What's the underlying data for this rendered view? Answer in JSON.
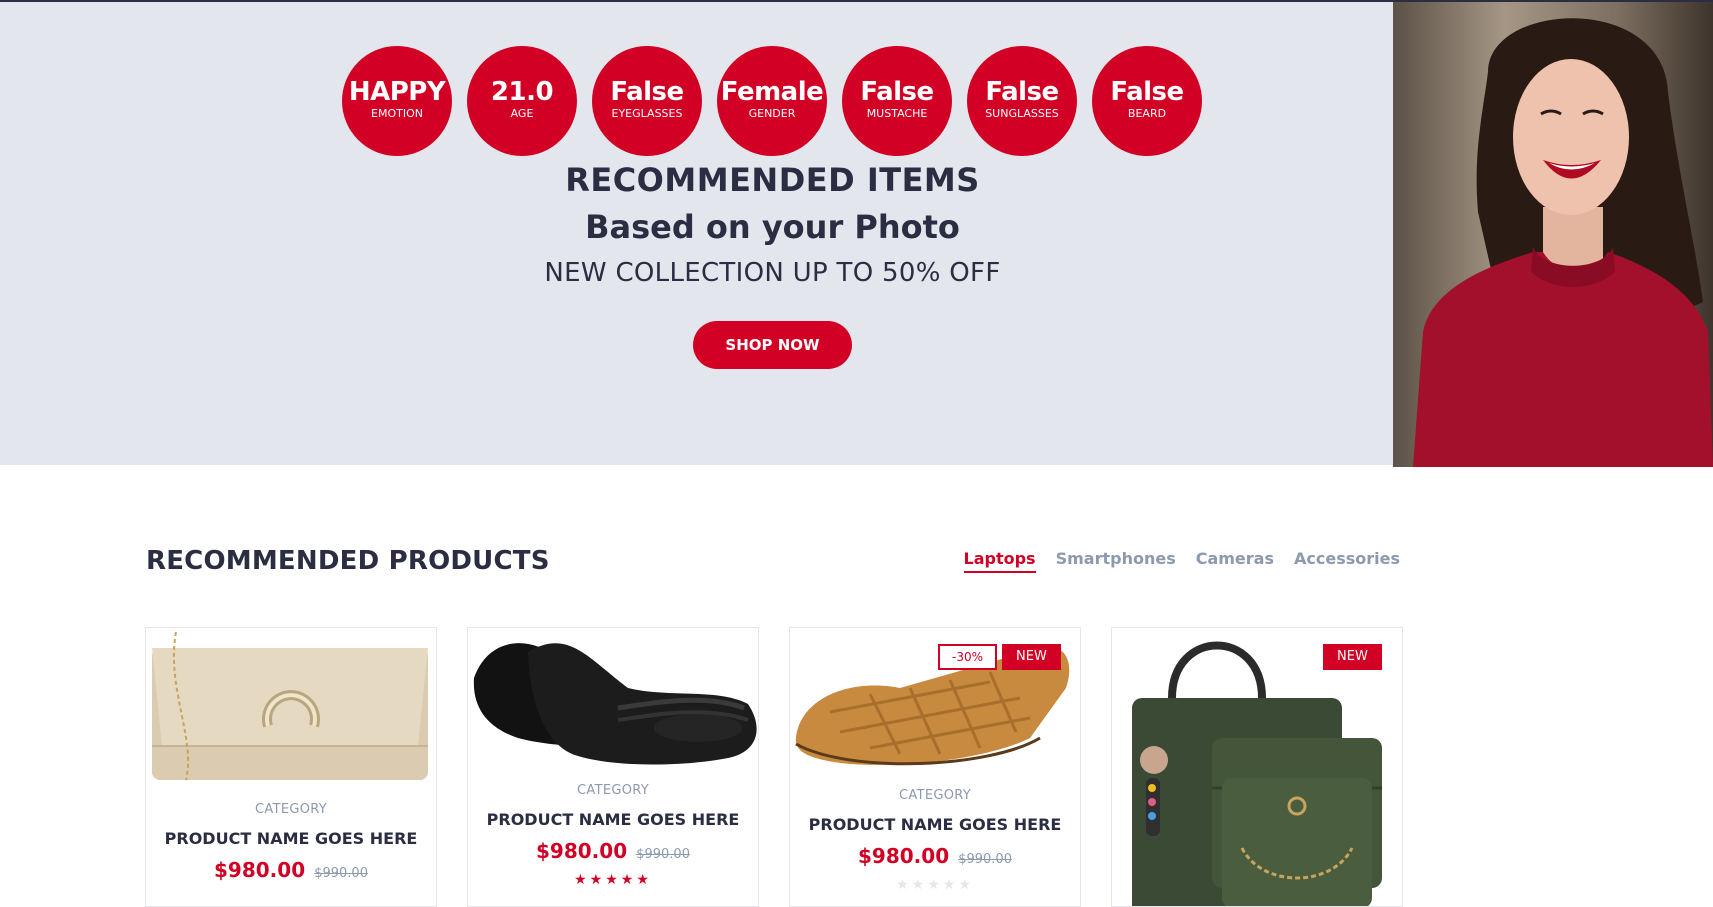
{
  "hero": {
    "attributes": [
      {
        "value": "HAPPY",
        "label": "EMOTION"
      },
      {
        "value": "21.0",
        "label": "AGE"
      },
      {
        "value": "False",
        "label": "EYEGLASSES"
      },
      {
        "value": "Female",
        "label": "GENDER"
      },
      {
        "value": "False",
        "label": "MUSTACHE"
      },
      {
        "value": "False",
        "label": "SUNGLASSES"
      },
      {
        "value": "False",
        "label": "BEARD"
      }
    ],
    "title": "RECOMMENDED ITEMS",
    "subtitle": "Based on your Photo",
    "offer": "NEW COLLECTION UP TO 50% OFF",
    "cta": "SHOP NOW"
  },
  "products_section": {
    "title": "RECOMMENDED PRODUCTS",
    "tabs": [
      "Laptops",
      "Smartphones",
      "Cameras",
      "Accessories"
    ],
    "active_tab": "Laptops"
  },
  "products": [
    {
      "category": "CATEGORY",
      "name": "PRODUCT NAME GOES HERE",
      "price": "$980.00",
      "old_price": "$990.00",
      "image": "gold-clutch-bag",
      "badges": []
    },
    {
      "category": "CATEGORY",
      "name": "PRODUCT NAME GOES HERE",
      "price": "$980.00",
      "old_price": "$990.00",
      "image": "black-flat-shoes",
      "badges": []
    },
    {
      "category": "CATEGORY",
      "name": "PRODUCT NAME GOES HERE",
      "price": "$980.00",
      "old_price": "$990.00",
      "image": "tan-woven-sandal",
      "badges": [
        "-30%",
        "NEW"
      ]
    },
    {
      "category": "CATEGORY",
      "name": "PRODUCT NAME GOES HERE",
      "price": "$980.00",
      "old_price": "$990.00",
      "image": "green-handbag-set",
      "badges": [
        "NEW"
      ]
    }
  ],
  "colors": {
    "accent": "#d10024",
    "dark": "#2b2d42",
    "muted": "#8d99ae",
    "hero_bg": "#e4e6ed"
  }
}
